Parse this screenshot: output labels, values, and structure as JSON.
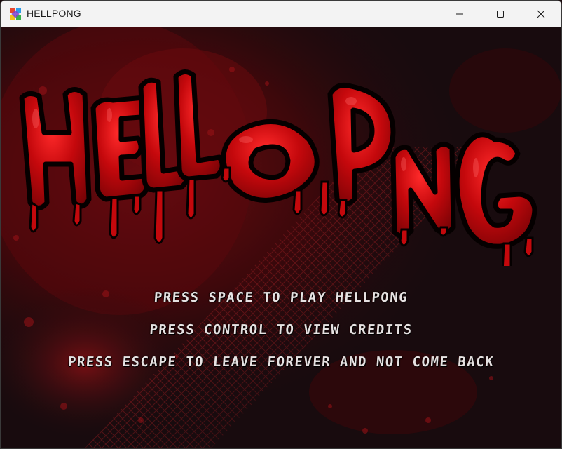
{
  "window": {
    "title": "HELLPONG",
    "app_icon": "colorful-app-icon",
    "controls": {
      "minimize_icon": "minimize-icon",
      "maximize_icon": "maximize-icon",
      "close_icon": "close-icon"
    }
  },
  "game": {
    "logo_text": "HELLPONG",
    "menu": [
      "PRESS SPACE TO PLAY HELLPONG",
      "PRESS CONTROL TO VIEW CREDITS",
      "PRESS ESCAPE TO LEAVE FOREVER AND NOT COME BACK"
    ],
    "colors": {
      "background": "#180b0e",
      "blood": "#c4080c",
      "blood_dark": "#6e0205",
      "menu_text": "#e6e2e2"
    }
  }
}
